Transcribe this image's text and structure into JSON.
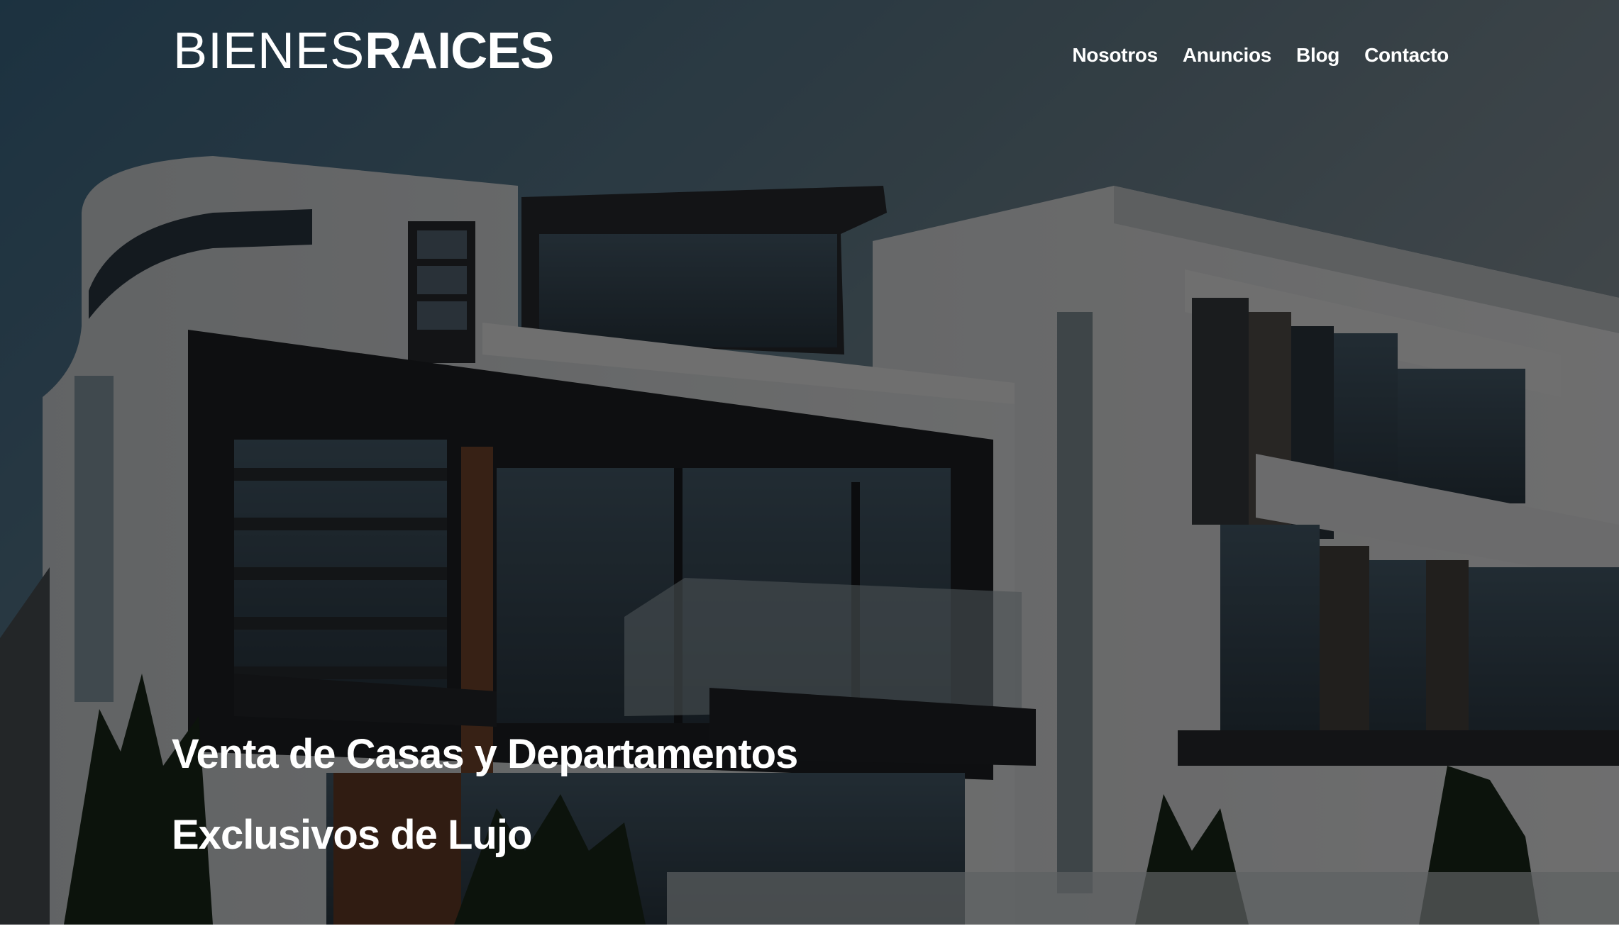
{
  "header": {
    "logo_light": "BIENES",
    "logo_bold": "RAICES"
  },
  "nav": {
    "items": [
      {
        "label": "Nosotros"
      },
      {
        "label": "Anuncios"
      },
      {
        "label": "Blog"
      },
      {
        "label": "Contacto"
      }
    ]
  },
  "hero": {
    "line1": "Venta de Casas y Departamentos",
    "line2": "Exclusivos de Lujo"
  },
  "colors": {
    "text": "#ffffff",
    "overlay": "rgba(0,0,0,0.55)"
  }
}
